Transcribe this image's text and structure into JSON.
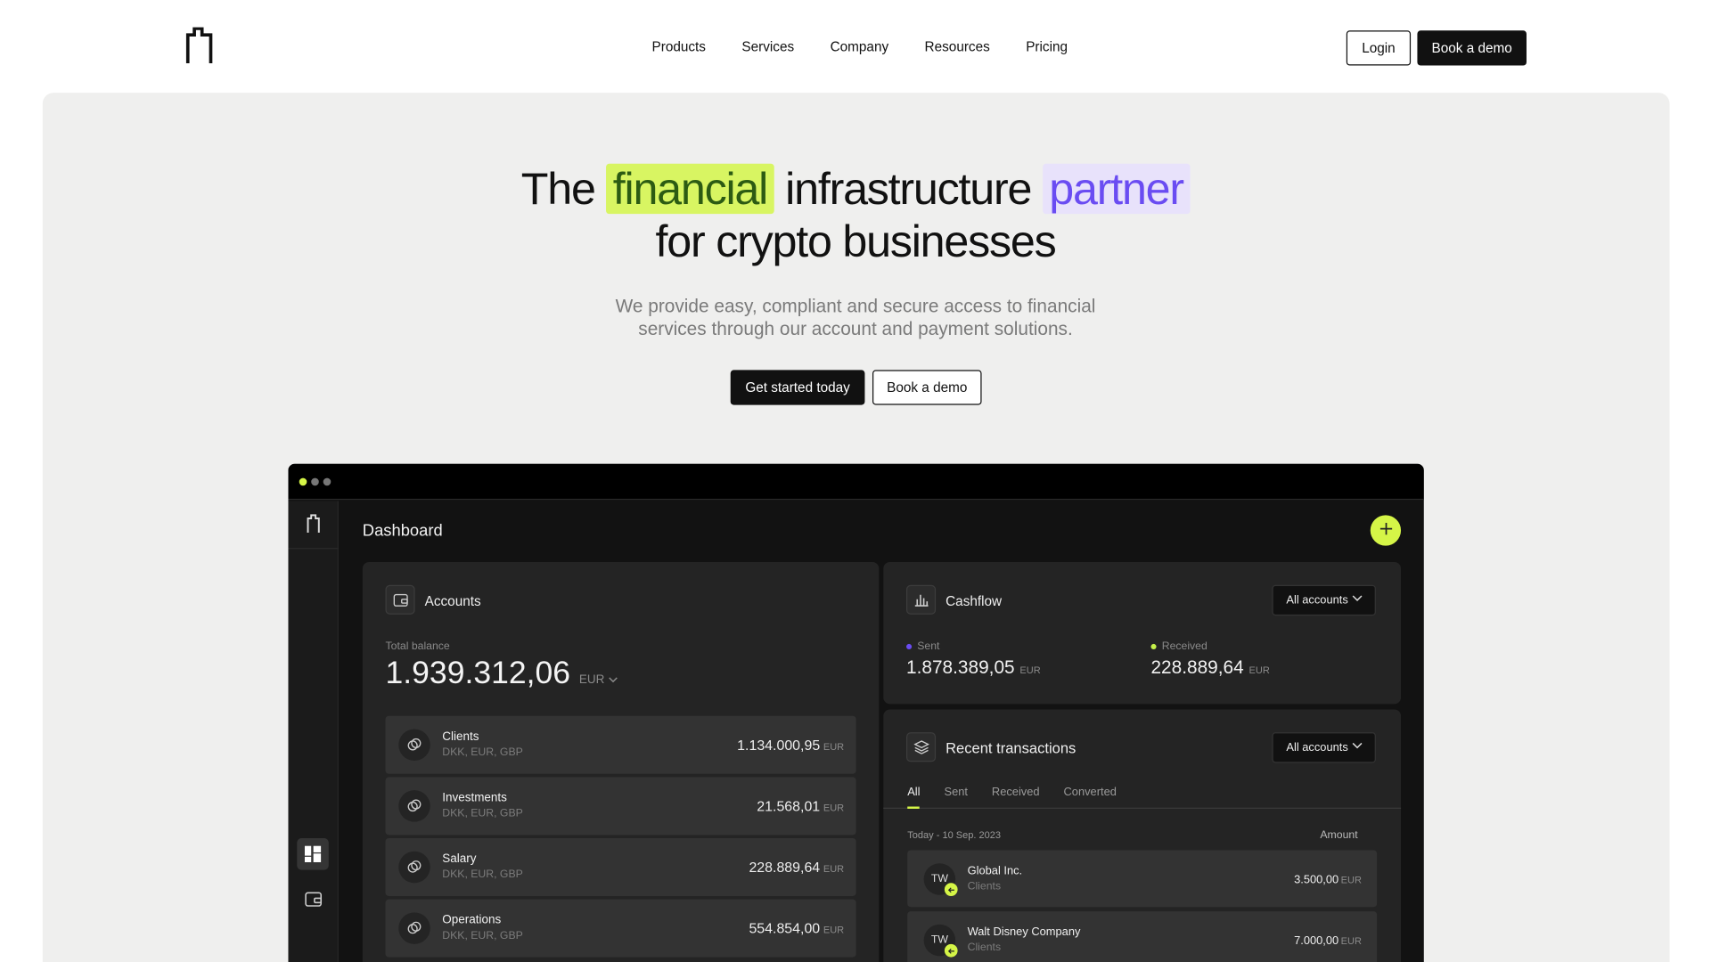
{
  "nav": {
    "logo": "brand-logo",
    "links": [
      "Products",
      "Services",
      "Company",
      "Resources",
      "Pricing"
    ],
    "login_label": "Login",
    "demo_label": "Book a demo"
  },
  "hero": {
    "title_the": "The",
    "title_highlight_1": "financial",
    "title_mid": "infrastructure",
    "title_highlight_2": "partner",
    "title_line2": "for crypto businesses",
    "subtitle_line1": "We provide easy, compliant and secure access to financial",
    "subtitle_line2": "services through our account and payment solutions.",
    "cta_primary": "Get started today",
    "cta_secondary": "Book a demo"
  },
  "colors": {
    "accent_lime": "#d5f547",
    "highlight_green_bg": "#d8f562",
    "highlight_purple_bg": "#e8e2fb",
    "highlight_purple_text": "#6a4cf2",
    "sent_dot": "#6a4cf2",
    "received_dot": "#c5f04a"
  },
  "app": {
    "page_title": "Dashboard",
    "add_button_icon": "plus-icon",
    "accounts": {
      "title": "Accounts",
      "total_label": "Total balance",
      "total_value": "1.939.312,06",
      "total_currency": "EUR",
      "rows": [
        {
          "name": "Clients",
          "currencies": "DKK, EUR, GBP",
          "amount": "1.134.000,95",
          "unit": "EUR"
        },
        {
          "name": "Investments",
          "currencies": "DKK, EUR, GBP",
          "amount": "21.568,01",
          "unit": "EUR"
        },
        {
          "name": "Salary",
          "currencies": "DKK, EUR, GBP",
          "amount": "228.889,64",
          "unit": "EUR"
        },
        {
          "name": "Operations",
          "currencies": "DKK, EUR, GBP",
          "amount": "554.854,00",
          "unit": "EUR"
        }
      ]
    },
    "cashflow": {
      "title": "Cashflow",
      "filter": "All accounts",
      "sent_label": "Sent",
      "sent_value": "1.878.389,05",
      "sent_unit": "EUR",
      "received_label": "Received",
      "received_value": "228.889,64",
      "received_unit": "EUR"
    },
    "transactions": {
      "title": "Recent transactions",
      "filter": "All accounts",
      "tabs": [
        "All",
        "Sent",
        "Received",
        "Converted"
      ],
      "date_label": "Today - 10 Sep. 2023",
      "amount_header": "Amount",
      "rows": [
        {
          "initials": "TW",
          "name": "Global Inc.",
          "category": "Clients",
          "amount": "3.500,00",
          "unit": "EUR"
        },
        {
          "initials": "TW",
          "name": "Walt Disney Company",
          "category": "Clients",
          "amount": "7.000,00",
          "unit": "EUR"
        }
      ]
    }
  }
}
